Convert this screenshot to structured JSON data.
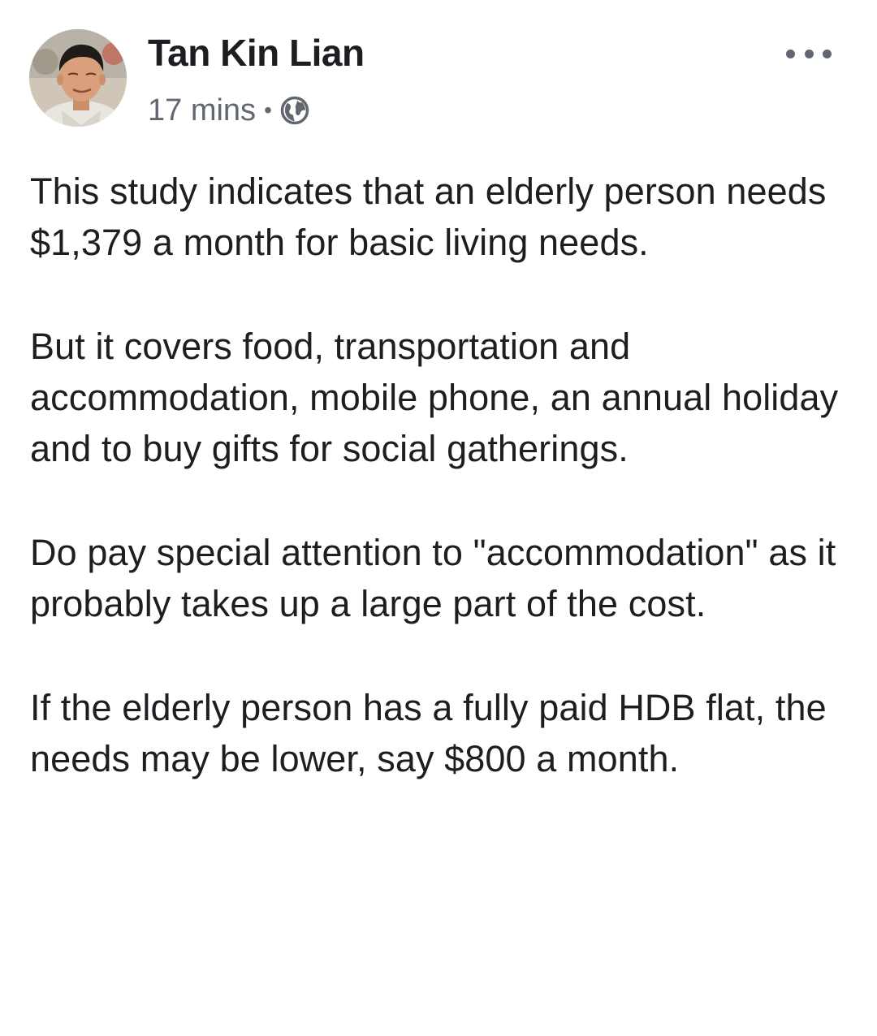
{
  "post": {
    "author": {
      "name": "Tan Kin Lian",
      "avatar_icon": "profile-photo"
    },
    "meta": {
      "time": "17 mins",
      "separator": "•",
      "privacy_icon": "globe-icon"
    },
    "menu_icon": "more-horizontal-icon",
    "paragraphs": [
      "This study indicates that an elderly person needs $1,379 a month for basic living needs.",
      "But it covers food, transportation and accommodation, mobile phone, an annual holiday and to buy gifts for social gatherings.",
      "Do pay special attention to \"accommodation\" as it probably takes up a large part of the cost.",
      "If the elderly person has a fully paid HDB flat, the needs may be lower, say $800 a month."
    ]
  },
  "colors": {
    "text_primary": "#1c1e21",
    "text_secondary": "#606770",
    "background": "#ffffff"
  }
}
